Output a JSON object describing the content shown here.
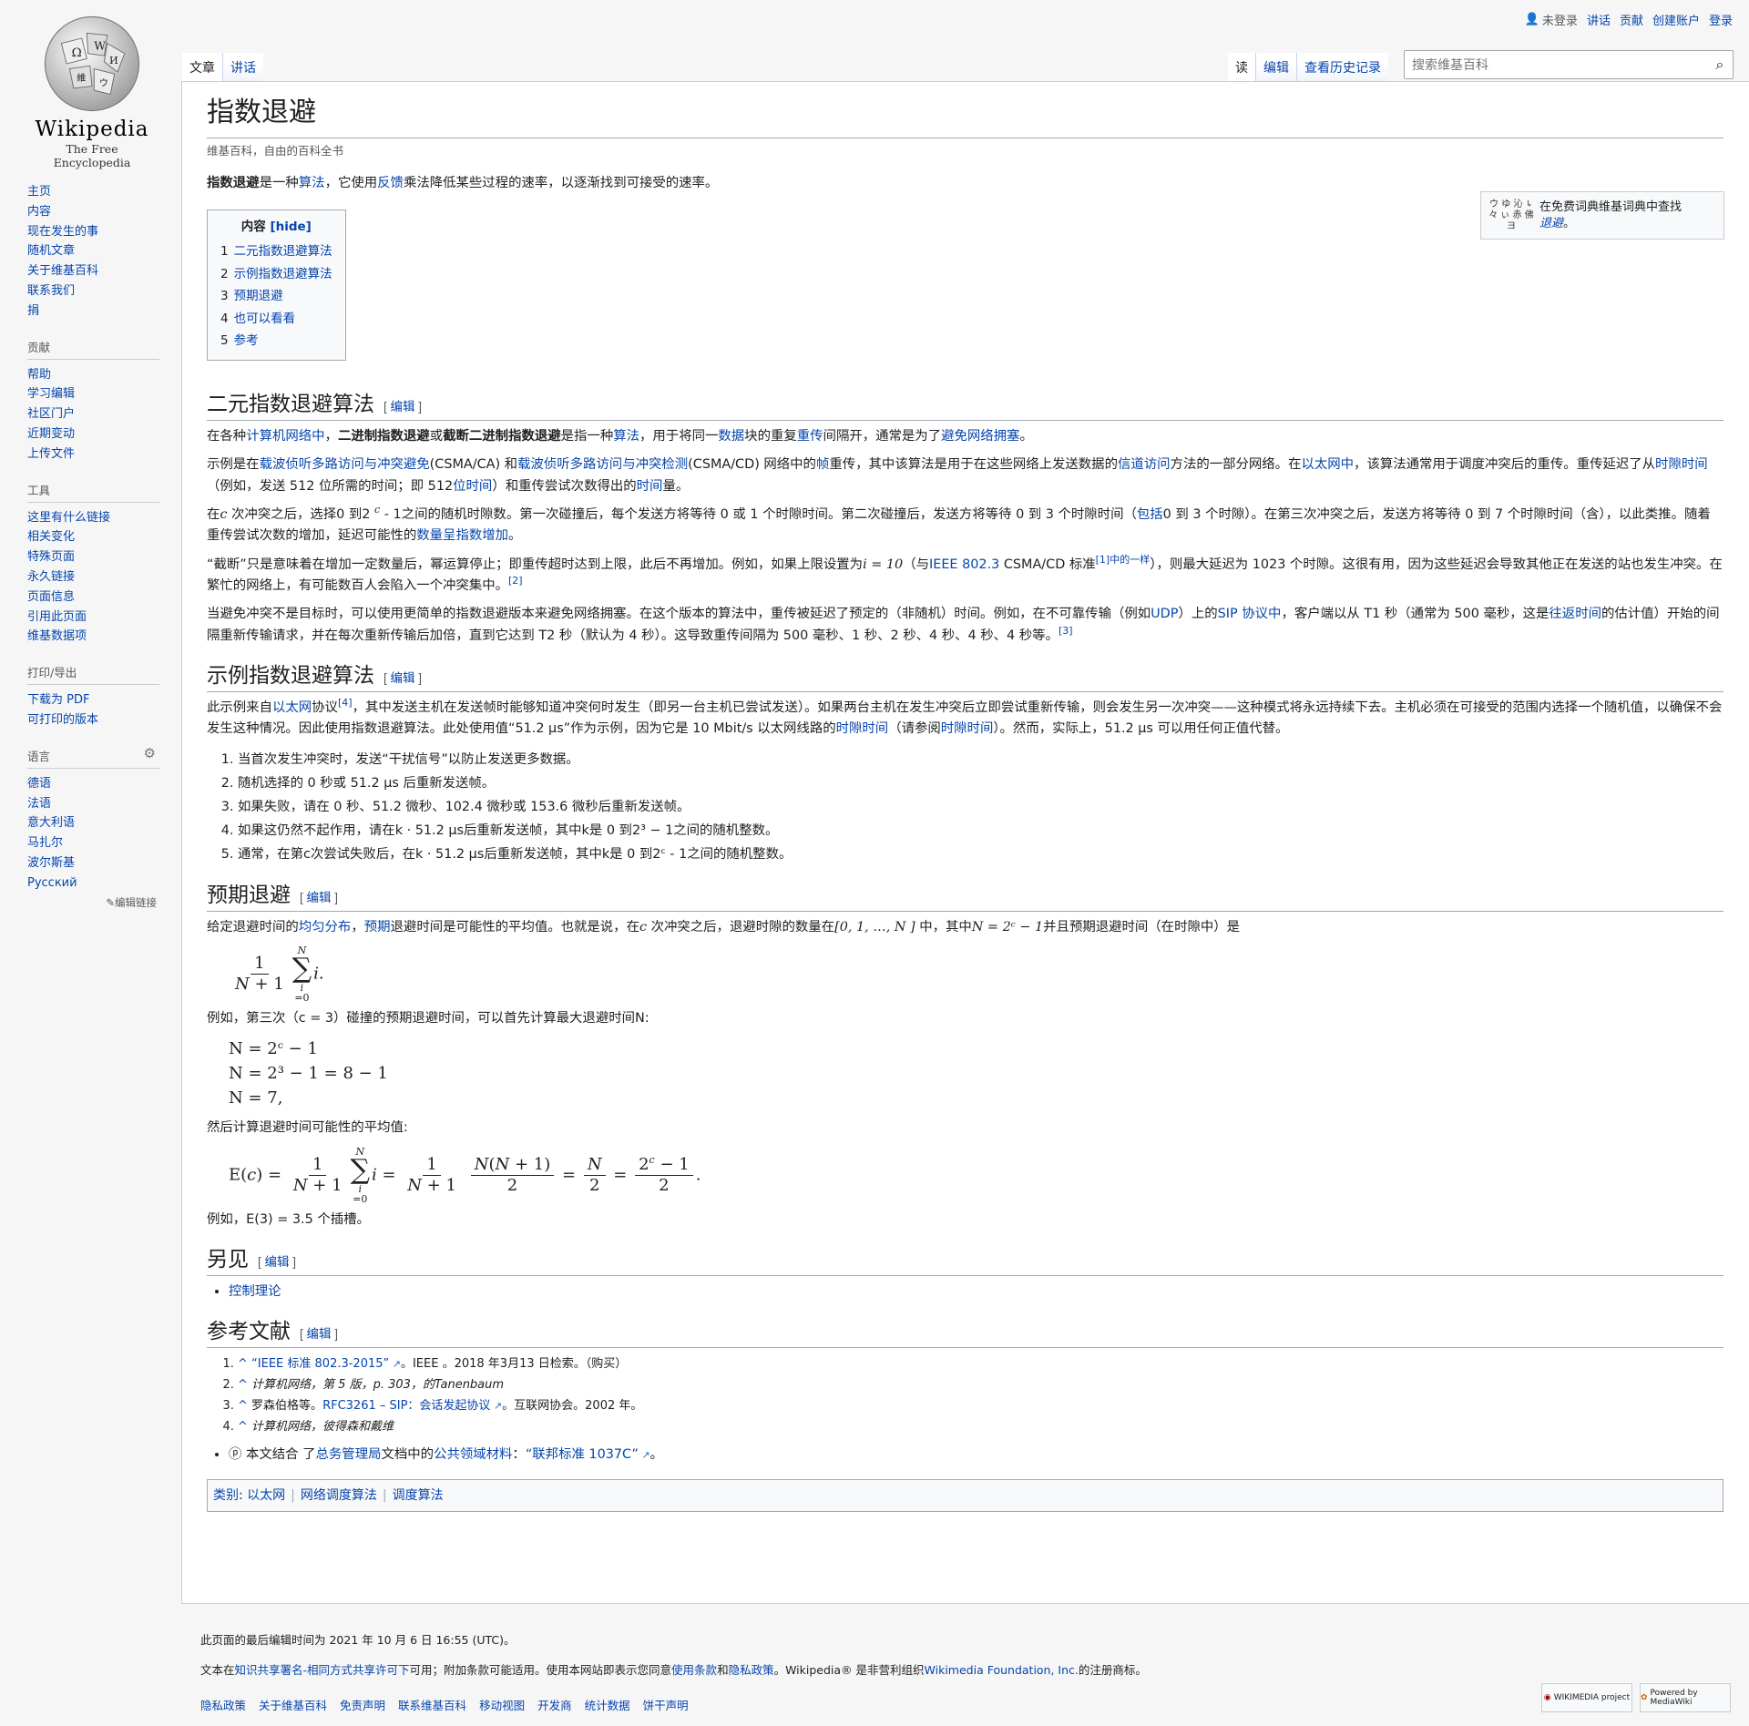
{
  "logo": {
    "wordmark": "Wikipedia",
    "tagline": "The Free Encyclopedia"
  },
  "personal": {
    "anon": "未登录",
    "talk": "讲话",
    "contrib": "贡献",
    "create": "创建账户",
    "login": "登录"
  },
  "tabs_left": [
    "文章",
    "讲话"
  ],
  "tabs_right": [
    "读",
    "编辑",
    "查看历史记录"
  ],
  "search": {
    "placeholder": "搜索维基百科"
  },
  "sidebar": {
    "nav": [
      "主页",
      "内容",
      "现在发生的事",
      "随机文章",
      "关于维基百科",
      "联系我们",
      "捐"
    ],
    "contribute_title": "贡献",
    "contribute": [
      "帮助",
      "学习编辑",
      "社区门户",
      "近期变动",
      "上传文件"
    ],
    "tools_title": "工具",
    "tools": [
      "这里有什么链接",
      "相关变化",
      "特殊页面",
      "永久链接",
      "页面信息",
      "引用此页面",
      "维基数据项"
    ],
    "print_title": "打印/导出",
    "print": [
      "下载为 PDF",
      "可打印的版本"
    ],
    "lang_title": "语言",
    "langs": [
      "德语",
      "法语",
      "意大利语",
      "马扎尔",
      "波尔斯基",
      "Русский"
    ],
    "edit_links": "编辑链接"
  },
  "article": {
    "title": "指数退避",
    "sitesub": "维基百科，自由的百科全书",
    "intro": {
      "bold": "指数退避",
      "t1": "是一种",
      "l1": "算法",
      "t2": "，它使用",
      "l2": "反馈",
      "t3": "乘法降低某些过程的速率，以逐渐找到可接受的速率。"
    },
    "wiktionary": {
      "text": "在免费词典维基词典中查找",
      "link": "退避",
      "logo": "ウ ゆ 沁 ↳ 々 ぃ 赤 佛 ヨ"
    },
    "toc": {
      "title": "内容",
      "hide": "[hide]",
      "items": [
        {
          "num": "1",
          "label": "二元指数退避算法"
        },
        {
          "num": "2",
          "label": "示例指数退避算法"
        },
        {
          "num": "3",
          "label": "预期退避"
        },
        {
          "num": "4",
          "label": "也可以看看"
        },
        {
          "num": "5",
          "label": "参考"
        }
      ]
    },
    "edit_label": "编辑",
    "s1": {
      "title": "二元指数退避算法",
      "p1": {
        "a": "在各种",
        "l1": "计算机网络中",
        "b1": "，",
        "bold1": "二进制指数退避",
        "b2": "或",
        "bold2": "截断二进制指数退避",
        "b3": "是指一种",
        "l2": "算法",
        "b4": "，用于将同一",
        "l3": "数据",
        "b5": "块的重复",
        "l4": "重传",
        "b6": "间隔开，通常是为了",
        "l5": "避免网络拥塞",
        "b7": "。"
      },
      "p2": {
        "a": "示例是在",
        "l1": "载波侦听多路访问与冲突避免",
        "b1": "(CSMA/CA) 和",
        "l2": "载波侦听多路访问与冲突检测",
        "b2": "(CSMA/CD) 网络中的",
        "l3": "帧",
        "b3": "重传，其中该算法是用于在这些网络上发送数据的",
        "l4": "信道访问",
        "b4": "方法的一部分网络。在",
        "l5": "以太网中",
        "b5": "，该算法通常用于调度冲突后的重传。重传延迟了从",
        "l6": "时隙时间",
        "b6": "（例如，发送 512 位所需的时间；即 512",
        "l7": "位时间",
        "b7": "）和重传尝试次数得出的",
        "l8": "时间",
        "b8": "量。"
      },
      "p3": {
        "a": "在",
        "b": " 次冲突之后，选择0 到2 ",
        "c": " - 1之间的随机时隙数。第一次碰撞后，每个发送方将等待 0 或 1 个时隙时间。第二次碰撞后，发送方将等待 0 到 3 个时隙时间（",
        "l1": "包括",
        "d": "0 到 3 个时隙）。在第三次冲突之后，发送方将等待 0 到 7 个时隙时间（含），以此类推。随着重传尝试次数的增加，延迟可能性的",
        "l2": "数量呈指数增加",
        "e": "。"
      },
      "p4": {
        "a": "“截断”只是意味着在增加一定数量后，幂运算停止；即重传超时达到上限，此后不再增加。例如，如果上限设置为",
        "m": "i = 10",
        "b": "（与",
        "l1": "IEEE 802.3",
        "c": " CSMA/CD 标准",
        "r1": "[1]",
        "l2": "中的一样",
        "d": "），则最大延迟为 1023 个时隙。这很有用，因为这些延迟会导致其他正在发送的站也发生冲突。在繁忙的网络上，有可能数百人会陷入一个冲突集中。",
        "r2": "[2]"
      },
      "p5": {
        "a": "当避免冲突不是目标时，可以使用更简单的指数退避版本来避免网络拥塞。在这个版本的算法中，重传被延迟了预定的（非随机）时间。例如，在不可靠传输（例如",
        "l1": "UDP",
        "b": "）上的",
        "l2": "SIP 协议中",
        "c": "，客户端以从 T1 秒（通常为 500 毫秒，这是",
        "l3": "往返时间",
        "d": "的估计值）开始的间隔重新传输请求，并在每次重新传输后加倍，直到它达到 T2 秒（默认为 4 秒）。这导致重传间隔为 500 毫秒、1 秒、2 秒、4 秒、4 秒、4 秒等。",
        "r3": "[3]"
      }
    },
    "s2": {
      "title": "示例指数退避算法",
      "p1": {
        "a": "此示例来自",
        "l1": "以太网",
        "b": "协议",
        "r4": "[4]",
        "c": "，其中发送主机在发送帧时能够知道冲突何时发生（即另一台主机已尝试发送）。如果两台主机在发生冲突后立即尝试重新传输，则会发生另一次冲突——这种模式将永远持续下去。主机必须在可接受的范围内选择一个随机值，以确保不会发生这种情况。因此使用指数退避算法。此处使用值“51.2 μs”作为示例，因为它是 10 Mbit/s 以太网线路的",
        "l2": "时隙时间",
        "d": "（请参阅",
        "l3": "时隙时间",
        "e": "）。然而，实际上，51.2 μs 可以用任何正值代替。"
      },
      "list": [
        "当首次发生冲突时，发送“干扰信号”以防止发送更多数据。",
        "随机选择的 0 秒或 51.2 μs 后重新发送帧。",
        "如果失败，请在 0 秒、51.2 微秒、102.4 微秒或 153.6 微秒后重新发送帧。",
        "如果这仍然不起作用，请在k · 51.2 μs后重新发送帧，其中k是 0 到2³ − 1之间的随机整数。",
        "通常，在第c次尝试失败后，在k · 51.2 μs后重新发送帧，其中k是 0 到2ᶜ - 1之间的随机整数。"
      ]
    },
    "s3": {
      "title": "预期退避",
      "p1": {
        "a": "给定退避时间的",
        "l1": "均匀分布",
        "b": "，",
        "l2": "预期",
        "c": "退避时间是可能性的平均值。也就是说，在",
        "m1": "c",
        "d": " 次冲突之后，退避时隙的数量在",
        "m2": "[0, 1, …, N ]",
        "e": " 中，其中",
        "m3": "N = 2ᶜ − 1",
        "f": "并且预期退避时间（在时隙中）是"
      },
      "p2": "例如，第三次（c = 3）碰撞的预期退避时间，可以首先计算最大退避时间N:",
      "eqs": [
        "N = 2ᶜ − 1",
        "N = 2³ − 1 = 8 − 1",
        "N = 7,"
      ],
      "p3": "然后计算退避时间可能性的平均值:",
      "p4": "例如，E(3) = 3.5 个插槽。"
    },
    "s4": {
      "title": "另见",
      "items": [
        "控制理论"
      ]
    },
    "s5": {
      "title": "参考文献",
      "refs": [
        {
          "caret": "^",
          "link": "“IEEE 标准 802.3-2015”",
          "rest": "。IEEE 。2018 年3月13 日检索。（购买）"
        },
        {
          "caret": "^",
          "link": "",
          "rest": "计算机网络，第 5 版，p. 303，的Tanenbaum"
        },
        {
          "caret": "^",
          "link": "RFC3261 – SIP：会话发起协议",
          "rest": "罗森伯格等。",
          "rest2": "。互联网协会。2002 年。"
        },
        {
          "caret": "^",
          "link": "",
          "rest": "计算机网络，彼得森和戴维"
        }
      ],
      "pd": {
        "a": "本文结合 了",
        "l1": "总务管理局",
        "b": "文档中的",
        "l2": "公共领域材料",
        "c": "：",
        "l3": "“联邦标准 1037C”",
        "d": "。"
      }
    },
    "categories": {
      "label": "类别",
      "items": [
        "以太网",
        "网络调度算法",
        "调度算法"
      ]
    }
  },
  "footer": {
    "lastmod": "此页面的最后编辑时间为 2021 年 10 月 6 日 16:55 (UTC)。",
    "license": {
      "a": "文本在",
      "l1": "知识共享署名-相同方式共享许可下",
      "b": "可用；附加条款可能适用。使用本网站即表示您同意",
      "l2": "使用条款",
      "c": "和",
      "l3": "隐私政策",
      "d": "。Wikipedia® 是非营利组织",
      "l4": "Wikimedia Foundation, Inc.",
      "e": "的注册商标。"
    },
    "links": [
      "隐私政策",
      "关于维基百科",
      "免责声明",
      "联系维基百科",
      "移动视图",
      "开发商",
      "统计数据",
      "饼干声明"
    ],
    "badge1": "WIKIMEDIA project",
    "badge2": "Powered by MediaWiki"
  }
}
